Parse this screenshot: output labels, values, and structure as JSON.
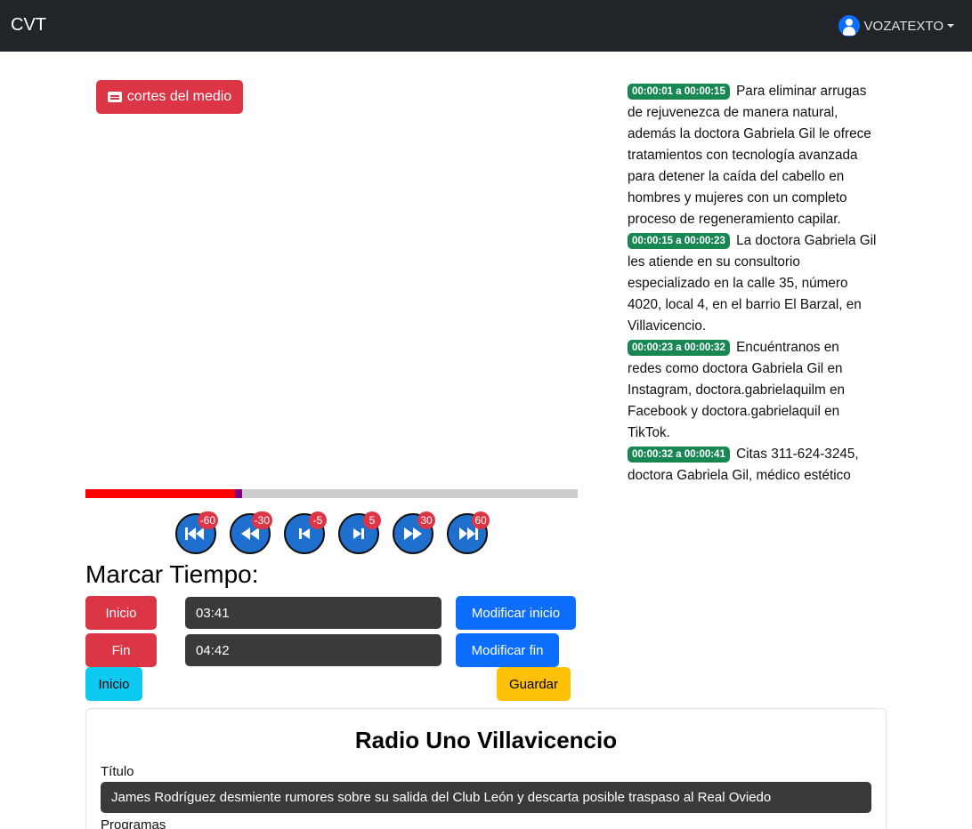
{
  "navbar": {
    "brand": "CVT",
    "user": "VOZATEXTO"
  },
  "media": {
    "cortes_label": "cortes del medio",
    "progress": {
      "played_fraction": 0.305
    }
  },
  "skip_buttons": [
    {
      "label": "-60",
      "icon": "double-skip-back-icon"
    },
    {
      "label": "-30",
      "icon": "rewind-icon"
    },
    {
      "label": "-5",
      "icon": "skip-back-icon"
    },
    {
      "label": "5",
      "icon": "skip-forward-icon"
    },
    {
      "label": "30",
      "icon": "fast-forward-icon"
    },
    {
      "label": "60",
      "icon": "double-skip-forward-icon"
    }
  ],
  "marcar": {
    "title": "Marcar Tiempo:",
    "inicio_label": "Inicio",
    "inicio_value": "03:41",
    "modificar_inicio_label": "Modificar inicio",
    "fin_label": "Fin",
    "fin_value": "04:42",
    "modificar_fin_label": "Modificar fin",
    "ir_inicio_label": "Inicio",
    "guardar_label": "Guardar"
  },
  "transcript": [
    {
      "time": "00:00:01 a 00:00:15",
      "text": "Para eliminar arrugas de rejuvenezca de manera natural, además la doctora Gabriela Gil le ofrece tratamientos con tecnología avanzada para detener la caída del cabello en hombres y mujeres con un completo proceso de regeneramiento capilar."
    },
    {
      "time": "00:00:15 a 00:00:23",
      "text": "La doctora Gabriela Gil les atiende en su consultorio especializado en la calle 35, número 4020, local 4, en el barrio El Barzal, en Villavicencio."
    },
    {
      "time": "00:00:23 a 00:00:32",
      "text": "Encuéntranos en redes como doctora Gabriela Gil en Instagram, doctora.gabrielaquilm en Facebook y doctora.gabrielaquil en TikTok."
    },
    {
      "time": "00:00:32 a 00:00:41",
      "text": "Citas 311-624-3245, doctora Gabriela Gil, médico estético"
    }
  ],
  "card": {
    "station": "Radio Uno Villavicencio",
    "titulo_label": "Título",
    "titulo_value": "James Rodríguez desmiente rumores sobre su salida del Club León y descarta posible traspaso al Real Oviedo",
    "programas_label": "Programas"
  },
  "colors": {
    "danger": "#dc3545",
    "primary": "#0d6efd",
    "info": "#0dcaf0",
    "warning": "#ffc107",
    "success": "#198754",
    "navbar": "#212529"
  }
}
